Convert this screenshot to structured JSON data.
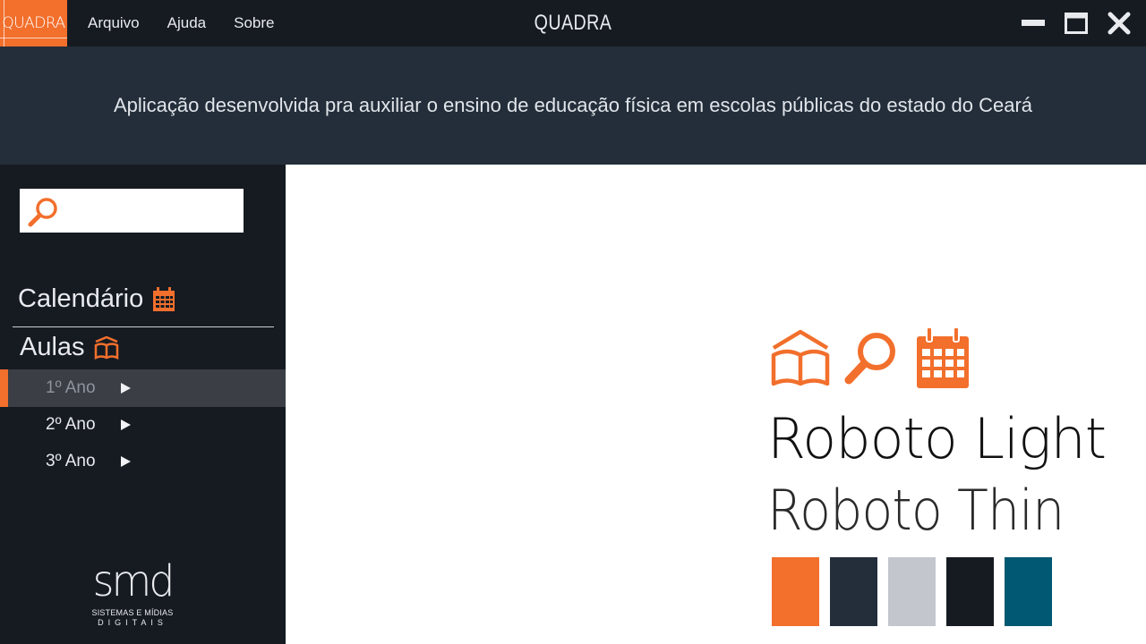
{
  "titlebar": {
    "logo_text": "QUADRA",
    "app_title": "QUADRA",
    "menu": [
      "Arquivo",
      "Ajuda",
      "Sobre"
    ],
    "controls": [
      "minimize-icon",
      "maximize-icon",
      "close-icon"
    ]
  },
  "banner": {
    "text": "Aplicação desenvolvida pra auxiliar o ensino de educação física em escolas públicas do estado do Ceará"
  },
  "sidebar": {
    "search": {
      "placeholder": "",
      "value": "",
      "icon": "search-icon"
    },
    "calendar_label": "Calendário",
    "calendar_icon": "calendar-icon",
    "lessons_label": "Aulas",
    "lessons_icon": "book-icon",
    "years": [
      {
        "label": "1º Ano",
        "active": true
      },
      {
        "label": "2º Ano",
        "active": false
      },
      {
        "label": "3º Ano",
        "active": false
      }
    ],
    "footer": {
      "mark": "smd",
      "line1": "SISTEMAS E MÍDIAS",
      "line2": "DIGITAIS"
    }
  },
  "main": {
    "icons": [
      "book-icon",
      "search-icon",
      "calendar-icon"
    ],
    "font_sample_1": "Roboto Light",
    "font_sample_2": "Roboto Thin",
    "palette": [
      "#f26f2c",
      "#232e3a",
      "#c3c6cd",
      "#161b22",
      "#005873"
    ]
  },
  "colors": {
    "accent": "#f26f2c",
    "titlebar_bg": "#161b22",
    "banner_bg": "#232e3a",
    "sidebar_bg": "#161b22",
    "active_item_bg": "#3b3f45"
  }
}
